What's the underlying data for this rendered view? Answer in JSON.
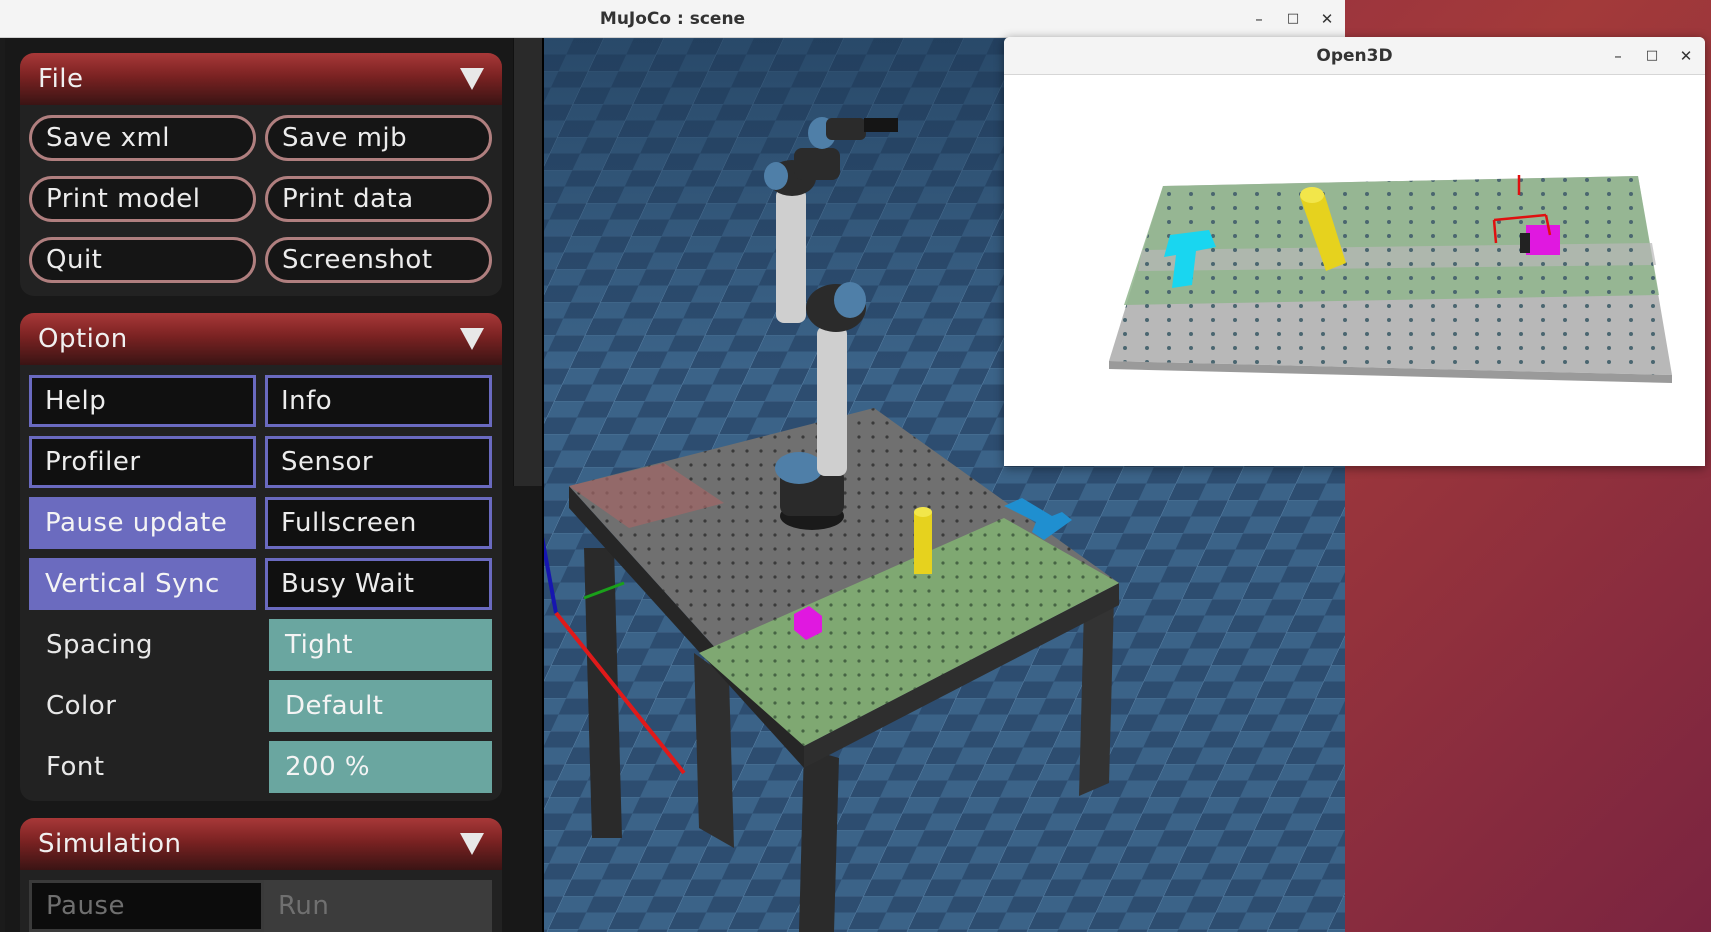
{
  "mujoco": {
    "title": "MuJoCo : scene",
    "controls": {
      "minimize": "–",
      "maximize": "□",
      "close": "✕"
    }
  },
  "file_section": {
    "header": "File",
    "buttons": [
      "Save xml",
      "Save mjb",
      "Print model",
      "Print data",
      "Quit",
      "Screenshot"
    ]
  },
  "option_section": {
    "header": "Option",
    "toggles": [
      {
        "label": "Help",
        "active": false
      },
      {
        "label": "Info",
        "active": false
      },
      {
        "label": "Profiler",
        "active": false
      },
      {
        "label": "Sensor",
        "active": false
      },
      {
        "label": "Pause update",
        "active": true
      },
      {
        "label": "Fullscreen",
        "active": false
      },
      {
        "label": "Vertical Sync",
        "active": true
      },
      {
        "label": "Busy Wait",
        "active": false
      }
    ],
    "settings": [
      {
        "label": "Spacing",
        "value": "Tight"
      },
      {
        "label": "Color",
        "value": "Default"
      },
      {
        "label": "Font",
        "value": "200 %"
      }
    ]
  },
  "simulation_section": {
    "header": "Simulation",
    "pause_label": "Pause",
    "run_label": "Run"
  },
  "open3d": {
    "title": "Open3D",
    "controls": {
      "minimize": "–",
      "maximize": "□",
      "close": "✕"
    }
  },
  "colors": {
    "section_header": "#a83838",
    "toggle_active": "#6b6bbf",
    "setting_value": "#6aa6a0",
    "cyan_object": "#19d6f0",
    "yellow_object": "#e6d21e",
    "magenta_object": "#e018e0",
    "green_zone": "#7fa872"
  }
}
